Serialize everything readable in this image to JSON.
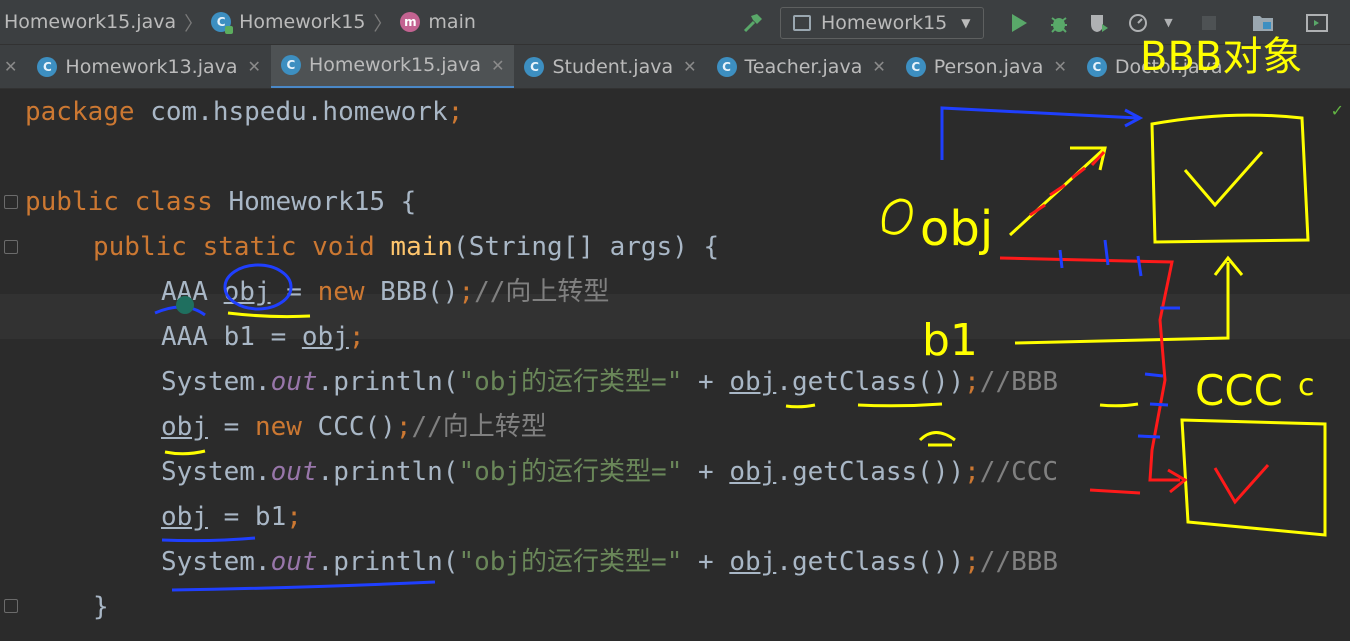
{
  "breadcrumb": {
    "file": "Homework15.java",
    "class": "Homework15",
    "method": "main"
  },
  "toolbar": {
    "run_config": "Homework15",
    "icons": [
      "build-hammer-icon",
      "run-icon",
      "debug-icon",
      "coverage-icon",
      "profile-icon",
      "stop-icon",
      "project-structure-icon",
      "terminal-icon"
    ]
  },
  "tabs": [
    {
      "label": "Homework13.java",
      "active": false
    },
    {
      "label": "Homework15.java",
      "active": true
    },
    {
      "label": "Student.java",
      "active": false
    },
    {
      "label": "Teacher.java",
      "active": false
    },
    {
      "label": "Person.java",
      "active": false
    },
    {
      "label": "Doctor.java",
      "active": false
    }
  ],
  "code": {
    "l1_kw": "package",
    "l1_rest": " com.hspedu.homework",
    "l1_semi": ";",
    "l3_kw": "public class",
    "l3_rest": " Homework15 {",
    "l4_kw1": "public static void",
    "l4_fn": "main",
    "l4_rest": "(String[] args) {",
    "l5_type": "AAA ",
    "l5_var": "obj",
    "l5_eq": " = ",
    "l5_new": "new",
    "l5_rest": " BBB()",
    "l5_semi": ";",
    "l5_cmt": "//向上转型",
    "l6_rest": "AAA b1 = ",
    "l6_var": "obj",
    "l6_semi": ";",
    "l7_sys": "System.",
    "l7_out": "out",
    "l7_println": ".println(",
    "l7_str": "\"obj的运行类型=\"",
    "l7_plus": " + ",
    "l7_var": "obj",
    "l7_get": ".getClass())",
    "l7_semi": ";",
    "l7_cmt": "//BBB",
    "l8_var": "obj",
    "l8_eq": " = ",
    "l8_new": "new",
    "l8_rest": " CCC()",
    "l8_semi": ";",
    "l8_cmt": "//向上转型",
    "l9_sys": "System.",
    "l9_out": "out",
    "l9_println": ".println(",
    "l9_str": "\"obj的运行类型=\"",
    "l9_plus": " + ",
    "l9_var": "obj",
    "l9_get": ".getClass())",
    "l9_semi": ";",
    "l9_cmt": "//CCC",
    "l10_var": "obj",
    "l10_rest": " = b1",
    "l10_semi": ";",
    "l11_sys": "System.",
    "l11_out": "out",
    "l11_println": ".println(",
    "l11_str": "\"obj的运行类型=\"",
    "l11_plus": " + ",
    "l11_var": "obj",
    "l11_get": ".getClass())",
    "l11_semi": ";",
    "l11_cmt": "//BBB",
    "l12_brace": "}"
  },
  "annotations": {
    "label_top": "BBB对象",
    "label_obj": "obj",
    "label_b1": "b1",
    "label_ccc": "CCC",
    "label_ccc_small": "c",
    "mark": "✓"
  },
  "colors": {
    "ink_yellow": "#ffff00",
    "ink_blue": "#1f3fff",
    "ink_red": "#ff1a1a",
    "accent_tab": "#4a88c7"
  }
}
